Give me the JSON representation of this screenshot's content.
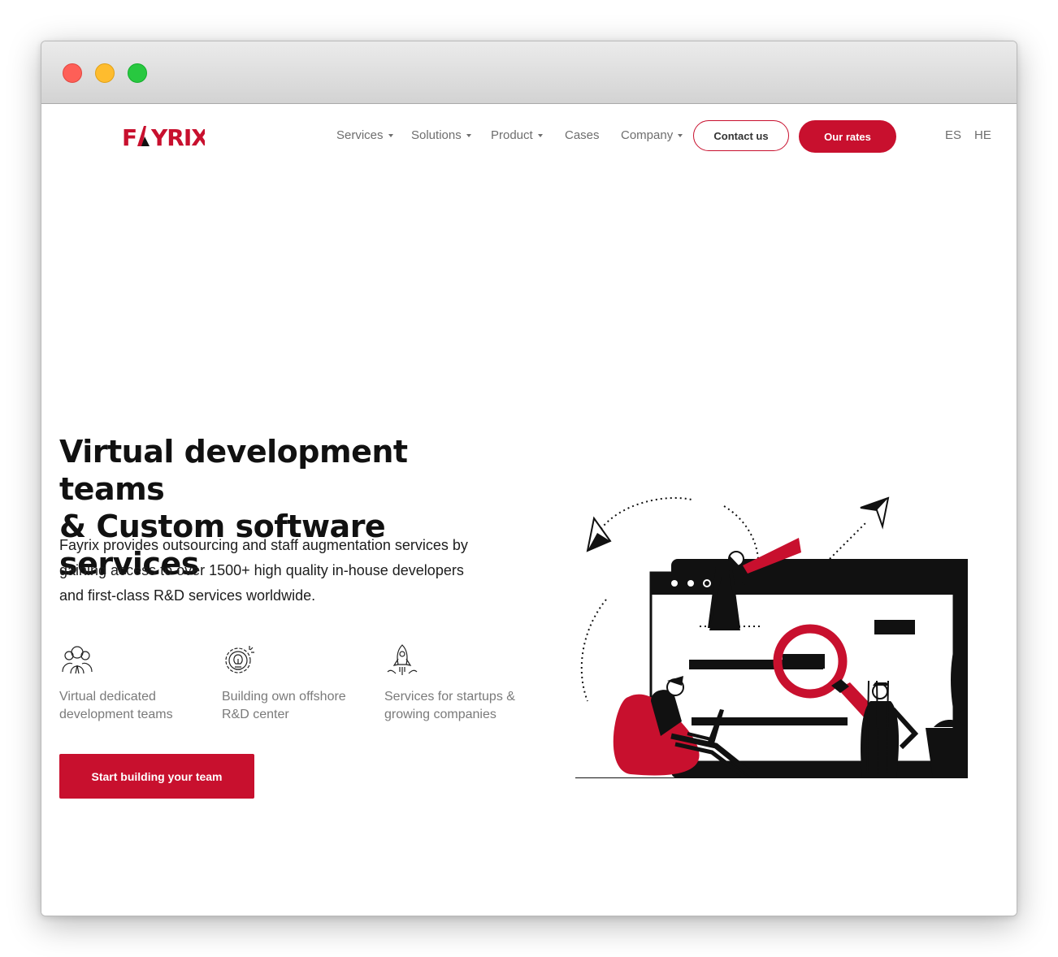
{
  "window": {
    "controls": [
      "close",
      "minimize",
      "maximize"
    ]
  },
  "header": {
    "logo_text": "FAYRIX",
    "nav": [
      {
        "label": "Services",
        "dropdown": true
      },
      {
        "label": "Solutions",
        "dropdown": true
      },
      {
        "label": "Product",
        "dropdown": true
      },
      {
        "label": "Cases",
        "dropdown": false
      },
      {
        "label": "Company",
        "dropdown": true
      }
    ],
    "contact_label": "Contact us",
    "rates_label": "Our rates",
    "languages": [
      "ES",
      "HE"
    ]
  },
  "hero": {
    "title_line1": "Virtual development teams",
    "title_line2": "& Custom software services",
    "description": "Fayrix provides outsourcing and staff augmentation services by gaining access to over 1500+ high quality in-house developers and first-class R&D services worldwide.",
    "features": [
      {
        "icon": "team-icon",
        "label_line1": "Virtual dedicated",
        "label_line2": "development teams"
      },
      {
        "icon": "lightbulb-gear-icon",
        "label_line1": "Building own offshore",
        "label_line2": "R&D center"
      },
      {
        "icon": "rocket-icon",
        "label_line1": "Services for startups &",
        "label_line2": "growing companies"
      }
    ],
    "cta_label": "Start building your team"
  },
  "colors": {
    "brand_red": "#c8102e",
    "text_dark": "#111111",
    "text_muted": "#7a7a7a"
  }
}
